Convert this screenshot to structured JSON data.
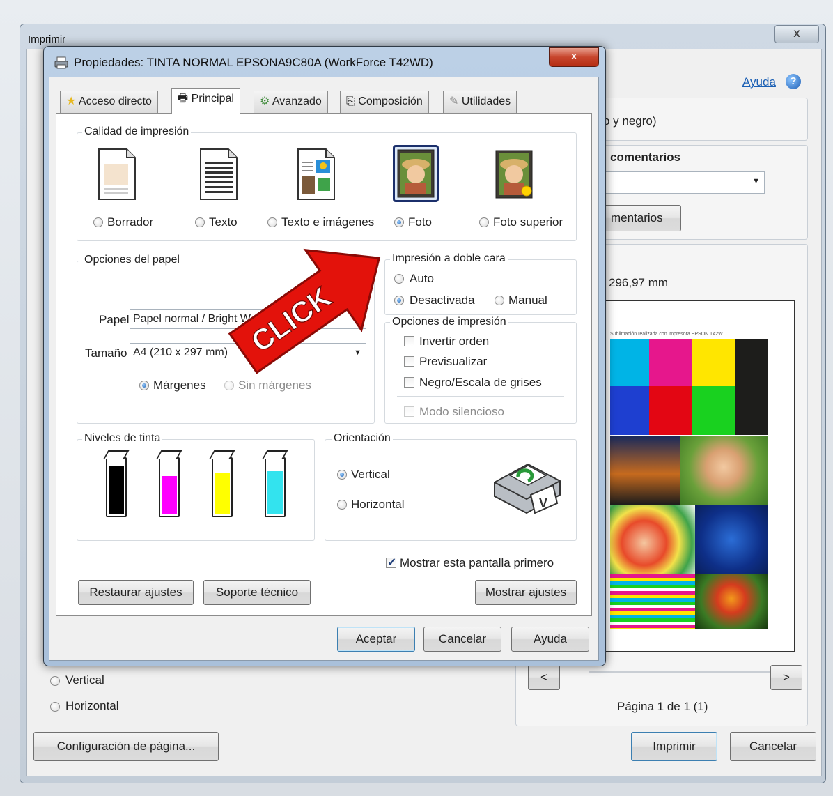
{
  "back_window": {
    "title": "Imprimir",
    "close_glyph": "X",
    "help_link": "Ayuda",
    "color_fragment": "o y negro)",
    "comments_heading": "comentarios",
    "comments_button_fragment": "mentarios",
    "size_fragment": "296,97 mm",
    "preview_header_fragment": "Sublimación realizada con impresora EPSON T42W",
    "preview_colors": [
      "#00b4e6",
      "#e6178c",
      "#ffe600",
      "#1d1d1b",
      "#1e3fd0",
      "#e30613",
      "#19d11f",
      "#1d1d1b"
    ],
    "orientation": {
      "vertical": "Vertical",
      "horizontal": "Horizontal"
    },
    "nav_prev": "<",
    "nav_next": ">",
    "page_indicator": "Página 1 de 1 (1)",
    "page_setup_button": "Configuración de página...",
    "print_button": "Imprimir",
    "cancel_button": "Cancelar"
  },
  "dialog": {
    "title": "Propiedades: TINTA NORMAL EPSONA9C80A (WorkForce T42WD)",
    "close_glyph": "x",
    "tabs": [
      {
        "label": "Acceso directo"
      },
      {
        "label": "Principal"
      },
      {
        "label": "Avanzado"
      },
      {
        "label": "Composición"
      },
      {
        "label": "Utilidades"
      }
    ],
    "quality": {
      "title": "Calidad de impresión",
      "options": [
        "Borrador",
        "Texto",
        "Texto e imágenes",
        "Foto",
        "Foto superior"
      ],
      "selected": "Foto"
    },
    "paper": {
      "title": "Opciones del papel",
      "paper_label": "Papel",
      "paper_value": "Papel normal / Bright W",
      "size_label": "Tamaño",
      "size_value": "A4 (210 x 297 mm)",
      "margins": "Márgenes",
      "borderless": "Sin márgenes"
    },
    "duplex": {
      "title": "Impresión a doble cara",
      "auto": "Auto",
      "off": "Desactivada",
      "manual": "Manual"
    },
    "print_options": {
      "title": "Opciones de impresión",
      "reverse": "Invertir orden",
      "preview": "Previsualizar",
      "grayscale": "Negro/Escala de grises",
      "quiet": "Modo silencioso"
    },
    "ink": {
      "title": "Niveles de tinta",
      "levels": [
        {
          "name": "black",
          "color": "#000000",
          "level": 0.9
        },
        {
          "name": "magenta",
          "color": "#ff00ff",
          "level": 0.72
        },
        {
          "name": "yellow",
          "color": "#ffff00",
          "level": 0.78
        },
        {
          "name": "cyan",
          "color": "#33e3ee",
          "level": 0.8
        }
      ]
    },
    "orientation": {
      "title": "Orientación",
      "vertical": "Vertical",
      "horizontal": "Horizontal"
    },
    "show_first": "Mostrar esta pantalla primero",
    "restore_button": "Restaurar ajustes",
    "support_button": "Soporte técnico",
    "show_settings_button": "Mostrar ajustes",
    "ok_button": "Aceptar",
    "cancel_button": "Cancelar",
    "help_button": "Ayuda"
  },
  "overlay": {
    "label": "CLICK",
    "color": "#e3120b"
  }
}
